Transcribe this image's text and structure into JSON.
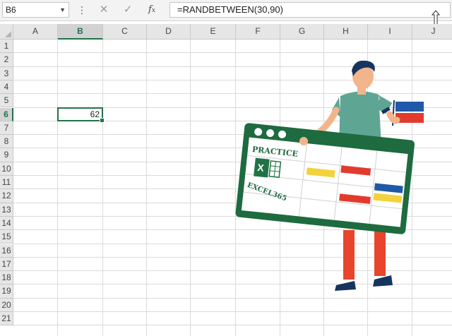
{
  "formula_bar": {
    "name_box": "B6",
    "more_icon": "more-vert-icon",
    "cancel_icon": "close-icon",
    "enter_icon": "checkmark-icon",
    "function_icon": "fx-icon",
    "formula": "=RANDBETWEEN(30,90)"
  },
  "columns": [
    "A",
    "B",
    "C",
    "D",
    "E",
    "F",
    "G",
    "H",
    "I",
    "J"
  ],
  "rows": [
    "1",
    "2",
    "3",
    "4",
    "5",
    "6",
    "7",
    "8",
    "9",
    "10",
    "11",
    "12",
    "13",
    "14",
    "15",
    "16",
    "17",
    "18",
    "19",
    "20",
    "21"
  ],
  "selected_column": "B",
  "selected_row": "6",
  "cells": {
    "B6": "62"
  },
  "illustration": {
    "logo_line1": "PRACTICE",
    "logo_line2": "EXCEL365",
    "logo_letter": "X",
    "colors": {
      "excel_green": "#217346",
      "board_green": "#1d6b3f",
      "shirt": "#5fa593",
      "pants": "#e8452c",
      "yellow": "#f2d33c",
      "red": "#e23b2e",
      "blue": "#1f5aa8"
    }
  }
}
